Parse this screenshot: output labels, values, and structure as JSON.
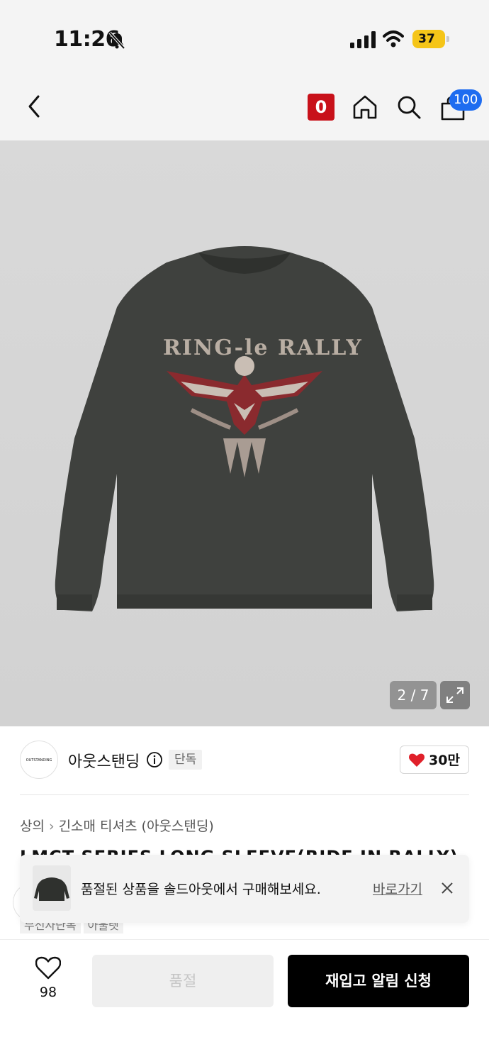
{
  "status": {
    "time": "11:26",
    "battery": "37"
  },
  "header": {
    "back_icon": "chevron-left-icon",
    "badge": "0",
    "cart_count": "100"
  },
  "gallery": {
    "counter": "2 / 7",
    "graphic_text": "RING-le RALLY"
  },
  "brand": {
    "logo_text": "OUTSTANDING",
    "name": "아웃스탠딩",
    "exclusive_label": "단독",
    "likes": "30만"
  },
  "breadcrumb": {
    "category": "상의",
    "subcategory": "긴소매 티셔츠 (아웃스탠딩)"
  },
  "product": {
    "title_partial": "LMCT SERIES LONG SLEEVE(RIDE IN RALLY)",
    "tags": [
      "무신사단독",
      "아울렛"
    ]
  },
  "toast": {
    "message": "품절된 상품을 솔드아웃에서 구매해보세요.",
    "link_label": "바로가기"
  },
  "bottom_bar": {
    "wish_count": "98",
    "soldout_label": "품절",
    "restock_label": "재입고 알림 신청"
  },
  "colors": {
    "accent_red": "#c8111a",
    "cart_badge": "#1e6cf0",
    "heart": "#e0202a",
    "battery": "#f5c518"
  }
}
